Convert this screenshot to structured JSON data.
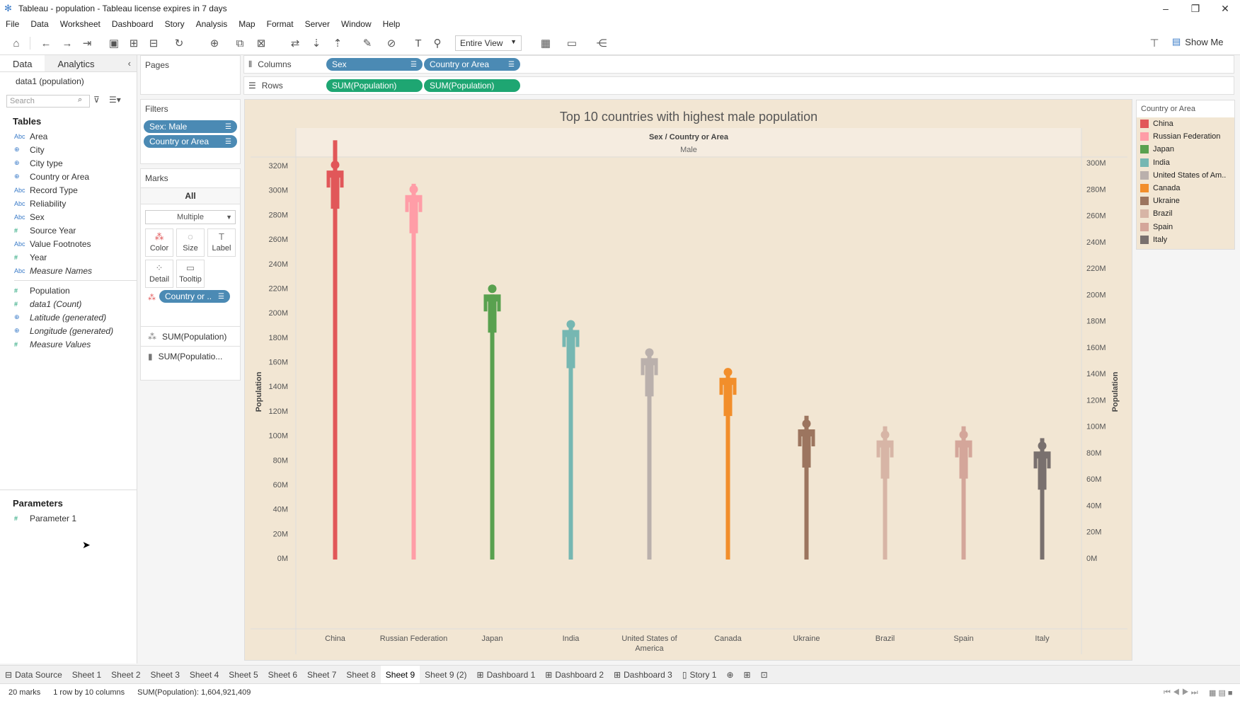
{
  "window": {
    "title": "Tableau - population - Tableau license expires in 7 days",
    "buttons": [
      "–",
      "❐",
      "✕"
    ]
  },
  "menu": [
    "File",
    "Data",
    "Worksheet",
    "Dashboard",
    "Story",
    "Analysis",
    "Map",
    "Format",
    "Server",
    "Window",
    "Help"
  ],
  "toolbar": {
    "view_select": "Entire View",
    "show_me": "Show Me"
  },
  "data_pane": {
    "tabs": [
      "Data",
      "Analytics"
    ],
    "datasource": "data1 (population)",
    "search_placeholder": "Search",
    "tables_header": "Tables",
    "dimensions": [
      {
        "icon": "Abc",
        "name": "Area"
      },
      {
        "icon": "⊕",
        "name": "City"
      },
      {
        "icon": "⊕",
        "name": "City type"
      },
      {
        "icon": "⊕",
        "name": "Country or Area"
      },
      {
        "icon": "Abc",
        "name": "Record Type"
      },
      {
        "icon": "Abc",
        "name": "Reliability"
      },
      {
        "icon": "Abc",
        "name": "Sex"
      },
      {
        "icon": "#",
        "name": "Source Year"
      },
      {
        "icon": "Abc",
        "name": "Value Footnotes"
      },
      {
        "icon": "#",
        "name": "Year"
      },
      {
        "icon": "Abc",
        "name": "Measure Names"
      }
    ],
    "measures": [
      {
        "icon": "#",
        "name": "Population"
      },
      {
        "icon": "#",
        "name": "data1 (Count)"
      },
      {
        "icon": "⊕",
        "name": "Latitude (generated)"
      },
      {
        "icon": "⊕",
        "name": "Longitude (generated)"
      },
      {
        "icon": "#",
        "name": "Measure Values"
      }
    ],
    "parameters_header": "Parameters",
    "parameters": [
      {
        "icon": "#",
        "name": "Parameter 1"
      }
    ]
  },
  "cards": {
    "pages": "Pages",
    "filters": "Filters",
    "filter_pills": [
      "Sex: Male",
      "Country or Area"
    ],
    "marks": "Marks",
    "marks_all": "All",
    "mark_type": "Multiple",
    "mark_buttons": [
      "Color",
      "Size",
      "Label",
      "Detail",
      "Tooltip"
    ],
    "color_pill": "Country or ..",
    "measure_rows": [
      "SUM(Population)",
      "SUM(Populatio..."
    ]
  },
  "shelves": {
    "columns_label": "Columns",
    "rows_label": "Rows",
    "columns": [
      "Sex",
      "Country or Area"
    ],
    "rows": [
      "SUM(Population)",
      "SUM(Population)"
    ]
  },
  "legend": {
    "title": "Country or Area",
    "items": [
      {
        "name": "China",
        "color": "#e15759"
      },
      {
        "name": "Russian Federation",
        "color": "#ff9da7"
      },
      {
        "name": "Japan",
        "color": "#59a14f"
      },
      {
        "name": "India",
        "color": "#76b7b2"
      },
      {
        "name": "United States of Am..",
        "color": "#bab0ac"
      },
      {
        "name": "Canada",
        "color": "#f28e2b"
      },
      {
        "name": "Ukraine",
        "color": "#9c755f"
      },
      {
        "name": "Brazil",
        "color": "#d7b5a6"
      },
      {
        "name": "Spain",
        "color": "#d4a69a"
      },
      {
        "name": "Italy",
        "color": "#79706e"
      }
    ]
  },
  "sheets": [
    "Data Source",
    "Sheet 1",
    "Sheet 2",
    "Sheet 3",
    "Sheet 4",
    "Sheet 5",
    "Sheet 6",
    "Sheet 7",
    "Sheet 8",
    "Sheet 9",
    "Sheet 9 (2)",
    "Dashboard 1",
    "Dashboard 2",
    "Dashboard 3",
    "Story 1"
  ],
  "active_sheet": "Sheet 9",
  "status": {
    "marks": "20 marks",
    "rows_cols": "1 row by 10 columns",
    "sum": "SUM(Population): 1,604,921,409"
  },
  "chart_data": {
    "type": "bar",
    "title": "Top 10 countries with highest male population",
    "header_top": "Sex / Country or Area",
    "header_sub": "Male",
    "ylabel": "Population",
    "y2label": "Population",
    "categories": [
      "China",
      "Russian Federation",
      "Japan",
      "India",
      "United States of America",
      "Canada",
      "Ukraine",
      "Brazil",
      "Spain",
      "Italy"
    ],
    "series": [
      {
        "name": "SUM(Population)",
        "values": [
          324000000,
          304000000,
          223000000,
          194000000,
          171000000,
          155000000,
          113000000,
          104000000,
          104000000,
          95000000
        ]
      },
      {
        "name": "SUM(Population)",
        "values": [
          317000000,
          284000000,
          200000000,
          180000000,
          158000000,
          144000000,
          108000000,
          100000000,
          100000000,
          91000000
        ]
      }
    ],
    "ylim": [
      0,
      320000000
    ],
    "y2lim": [
      0,
      300000000
    ],
    "yticks": [
      "0M",
      "20M",
      "40M",
      "60M",
      "80M",
      "100M",
      "120M",
      "140M",
      "160M",
      "180M",
      "200M",
      "220M",
      "240M",
      "260M",
      "280M",
      "300M",
      "320M"
    ],
    "y2ticks": [
      "0M",
      "20M",
      "40M",
      "60M",
      "80M",
      "100M",
      "120M",
      "140M",
      "160M",
      "180M",
      "200M",
      "220M",
      "240M",
      "260M",
      "280M",
      "300M"
    ],
    "grid": false
  }
}
